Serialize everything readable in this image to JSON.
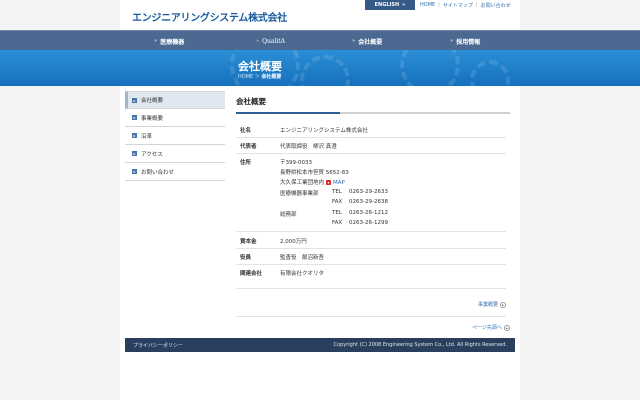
{
  "header": {
    "logo": "エンジニアリングシステム株式会社",
    "english_btn": "ENGLISH",
    "english_arrow": "»",
    "links": [
      "HOME",
      "サイトマップ",
      "お問い合わせ"
    ],
    "sep": "|"
  },
  "nav": {
    "arrow": "»",
    "items": [
      "医療機器",
      "QualitA",
      "会社概要",
      "採用情報"
    ]
  },
  "banner": {
    "title": "会社概要",
    "crumb_home": "HOME",
    "crumb_sep": "＞",
    "crumb_current": "会社概要"
  },
  "sidebar": {
    "items": [
      "会社概要",
      "事業概要",
      "沿革",
      "アクセス",
      "お問い合わせ"
    ]
  },
  "main": {
    "title": "会社概要",
    "company": {
      "label": "社名",
      "value": "エンジニアリングシステム株式会社"
    },
    "rep": {
      "label": "代表者",
      "value": "代表取締役　柳沢 真澄"
    },
    "address": {
      "label": "住所",
      "postal": "〒399-0033",
      "line1": "長野県松本市笹賀 5652-83",
      "line2": "大久保工業団地内",
      "map": "MAP",
      "div1_name": "医療機器事業部",
      "div1_tel_label": "TEL",
      "div1_tel": "0263-29-2633",
      "div1_fax_label": "FAX",
      "div1_fax": "0263-29-2638",
      "div2_name": "総務部",
      "div2_tel_label": "TEL",
      "div2_tel": "0263-26-1212",
      "div2_fax_label": "FAX",
      "div2_fax": "0263-26-1299"
    },
    "capital": {
      "label": "資本金",
      "value": "2,000万円"
    },
    "officer": {
      "label": "役員",
      "value": "監査役　飯沼新吾"
    },
    "related": {
      "label": "関連会社",
      "value": "有限会社クオリタ"
    },
    "next_link": "事業概要",
    "pagetop": "ページ先頭へ"
  },
  "footer": {
    "privacy": "プライバシーポリシー",
    "copyright": "Copyright (C) 2008 Engineering System Co., Ltd. All Rights Reserved."
  }
}
